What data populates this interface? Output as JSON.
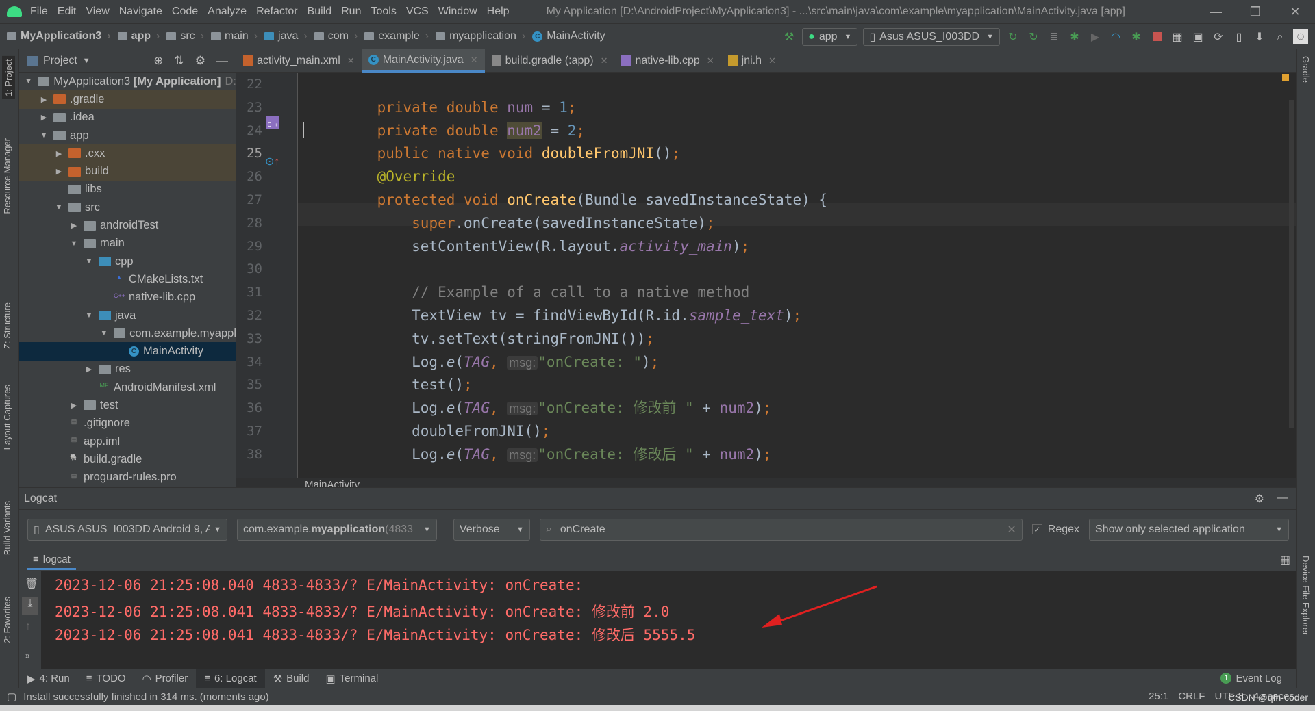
{
  "window": {
    "title": "My Application [D:\\AndroidProject\\MyApplication3] - ...\\src\\main\\java\\com\\example\\myapplication\\MainActivity.java [app]",
    "controls": [
      "—",
      "❐",
      "✕"
    ]
  },
  "menu": [
    "File",
    "Edit",
    "View",
    "Navigate",
    "Code",
    "Analyze",
    "Refactor",
    "Build",
    "Run",
    "Tools",
    "VCS",
    "Window",
    "Help"
  ],
  "breadcrumb": [
    "MyApplication3",
    "app",
    "src",
    "main",
    "java",
    "com",
    "example",
    "myapplication",
    "MainActivity"
  ],
  "toolbar": {
    "run_config": "app",
    "device": "Asus ASUS_I003DD"
  },
  "project_panel": {
    "title": "Project",
    "tree": [
      {
        "label": "MyApplication3 [My Application]",
        "suffix": "D:",
        "depth": 0,
        "arrow": "▼",
        "icon": "project"
      },
      {
        "label": ".gradle",
        "depth": 1,
        "arrow": "▶",
        "icon": "folder-orange",
        "ignored": true
      },
      {
        "label": ".idea",
        "depth": 1,
        "arrow": "▶",
        "icon": "folder"
      },
      {
        "label": "app",
        "depth": 1,
        "arrow": "▼",
        "icon": "folder"
      },
      {
        "label": ".cxx",
        "depth": 2,
        "arrow": "▶",
        "icon": "folder-orange",
        "ignored": true
      },
      {
        "label": "build",
        "depth": 2,
        "arrow": "▶",
        "icon": "folder-orange",
        "ignored": true
      },
      {
        "label": "libs",
        "depth": 2,
        "arrow": "",
        "icon": "folder"
      },
      {
        "label": "src",
        "depth": 2,
        "arrow": "▼",
        "icon": "folder"
      },
      {
        "label": "androidTest",
        "depth": 3,
        "arrow": "▶",
        "icon": "folder"
      },
      {
        "label": "main",
        "depth": 3,
        "arrow": "▼",
        "icon": "folder"
      },
      {
        "label": "cpp",
        "depth": 4,
        "arrow": "▼",
        "icon": "folder-blue"
      },
      {
        "label": "CMakeLists.txt",
        "depth": 5,
        "arrow": "",
        "icon": "cmake"
      },
      {
        "label": "native-lib.cpp",
        "depth": 5,
        "arrow": "",
        "icon": "cpp"
      },
      {
        "label": "java",
        "depth": 4,
        "arrow": "▼",
        "icon": "folder-blue"
      },
      {
        "label": "com.example.myappl",
        "depth": 5,
        "arrow": "▼",
        "icon": "package"
      },
      {
        "label": "MainActivity",
        "depth": 6,
        "arrow": "",
        "icon": "class",
        "selected": true
      },
      {
        "label": "res",
        "depth": 4,
        "arrow": "▶",
        "icon": "folder"
      },
      {
        "label": "AndroidManifest.xml",
        "depth": 4,
        "arrow": "",
        "icon": "manifest"
      },
      {
        "label": "test",
        "depth": 3,
        "arrow": "▶",
        "icon": "folder"
      },
      {
        "label": ".gitignore",
        "depth": 2,
        "arrow": "",
        "icon": "file"
      },
      {
        "label": "app.iml",
        "depth": 2,
        "arrow": "",
        "icon": "file"
      },
      {
        "label": "build.gradle",
        "depth": 2,
        "arrow": "",
        "icon": "gradle"
      },
      {
        "label": "proguard-rules.pro",
        "depth": 2,
        "arrow": "",
        "icon": "file"
      }
    ]
  },
  "tabs": [
    {
      "label": "activity_main.xml",
      "icon": "xml",
      "active": false
    },
    {
      "label": "MainActivity.java",
      "icon": "class",
      "active": true
    },
    {
      "label": "build.gradle (:app)",
      "icon": "gradle",
      "active": false
    },
    {
      "label": "native-lib.cpp",
      "icon": "cpp",
      "active": false
    },
    {
      "label": "jni.h",
      "icon": "header",
      "active": false
    }
  ],
  "editor": {
    "breadcrumb": "MainActivity",
    "caret_line": 25,
    "lines": [
      {
        "n": 22,
        "t": []
      },
      {
        "n": 23,
        "t": [
          [
            "    ",
            "pl"
          ],
          [
            "private double ",
            "kw"
          ],
          [
            "num",
            "fld"
          ],
          [
            " = ",
            "pl"
          ],
          [
            "1",
            "num"
          ],
          [
            ";",
            "kw"
          ]
        ]
      },
      {
        "n": 24,
        "t": [
          [
            "    ",
            "pl"
          ],
          [
            "private double ",
            "kw"
          ],
          [
            "num2",
            "fld hl"
          ],
          [
            " = ",
            "pl"
          ],
          [
            "2",
            "num"
          ],
          [
            ";",
            "kw"
          ]
        ]
      },
      {
        "n": 25,
        "t": [
          [
            "    ",
            "pl"
          ],
          [
            "public native void ",
            "kw"
          ],
          [
            "doubleFromJNI",
            "fn"
          ],
          [
            "()",
            "pl"
          ],
          [
            ";",
            "kw"
          ]
        ]
      },
      {
        "n": 26,
        "t": [
          [
            "    ",
            "pl"
          ],
          [
            "@Override",
            "ann"
          ]
        ]
      },
      {
        "n": 27,
        "t": [
          [
            "    ",
            "pl"
          ],
          [
            "protected void ",
            "kw"
          ],
          [
            "onCreate",
            "fn"
          ],
          [
            "(Bundle savedInstanceState) {",
            "pl"
          ]
        ]
      },
      {
        "n": 28,
        "t": [
          [
            "        ",
            "pl"
          ],
          [
            "super",
            "kw"
          ],
          [
            ".onCreate(savedInstanceState)",
            "pl"
          ],
          [
            ";",
            "kw"
          ]
        ]
      },
      {
        "n": 29,
        "t": [
          [
            "        setContentView(R.layout.",
            "pl"
          ],
          [
            "activity_main",
            "fld it"
          ],
          [
            ")",
            "pl"
          ],
          [
            ";",
            "kw"
          ]
        ]
      },
      {
        "n": 30,
        "t": []
      },
      {
        "n": 31,
        "t": [
          [
            "        ",
            "pl"
          ],
          [
            "// Example of a call to a native method",
            "cm"
          ]
        ]
      },
      {
        "n": 32,
        "t": [
          [
            "        TextView tv = findViewById(R.id.",
            "pl"
          ],
          [
            "sample_text",
            "fld it"
          ],
          [
            ")",
            "pl"
          ],
          [
            ";",
            "kw"
          ]
        ]
      },
      {
        "n": 33,
        "t": [
          [
            "        tv.setText(stringFromJNI())",
            "pl"
          ],
          [
            ";",
            "kw"
          ]
        ]
      },
      {
        "n": 34,
        "t": [
          [
            "        Log.",
            "pl"
          ],
          [
            "e",
            "pl it"
          ],
          [
            "(",
            "pl"
          ],
          [
            "TAG",
            "fld it"
          ],
          [
            ", ",
            "kw"
          ],
          [
            "msg:",
            "hint"
          ],
          [
            "\"onCreate: \"",
            "str"
          ],
          [
            ")",
            "pl"
          ],
          [
            ";",
            "kw"
          ]
        ]
      },
      {
        "n": 35,
        "t": [
          [
            "        test()",
            "pl"
          ],
          [
            ";",
            "kw"
          ]
        ]
      },
      {
        "n": 36,
        "t": [
          [
            "        Log.",
            "pl"
          ],
          [
            "e",
            "pl it"
          ],
          [
            "(",
            "pl"
          ],
          [
            "TAG",
            "fld it"
          ],
          [
            ", ",
            "kw"
          ],
          [
            "msg:",
            "hint"
          ],
          [
            "\"onCreate: 修改前 \"",
            "str"
          ],
          [
            " + ",
            "pl"
          ],
          [
            "num2",
            "fld"
          ],
          [
            ")",
            "pl"
          ],
          [
            ";",
            "kw"
          ]
        ]
      },
      {
        "n": 37,
        "t": [
          [
            "        doubleFromJNI()",
            "pl"
          ],
          [
            ";",
            "kw"
          ]
        ]
      },
      {
        "n": 38,
        "t": [
          [
            "        Log.",
            "pl"
          ],
          [
            "e",
            "pl it"
          ],
          [
            "(",
            "pl"
          ],
          [
            "TAG",
            "fld it"
          ],
          [
            ", ",
            "kw"
          ],
          [
            "msg:",
            "hint"
          ],
          [
            "\"onCreate: 修改后 \"",
            "str"
          ],
          [
            " + ",
            "pl"
          ],
          [
            "num2",
            "fld"
          ],
          [
            ")",
            "pl"
          ],
          [
            ";",
            "kw"
          ]
        ]
      }
    ]
  },
  "logcat": {
    "title": "Logcat",
    "device": "ASUS ASUS_I003DD Android 9, A",
    "process": {
      "prefix": "com.example.",
      "bold": "myapplication",
      "pid": " (4833"
    },
    "level": "Verbose",
    "search": "onCreate",
    "regex_label": "Regex",
    "regex_checked": true,
    "filter": "Show only selected application",
    "tab": "logcat",
    "lines": [
      "2023-12-06 21:25:08.040 4833-4833/? E/MainActivity: onCreate: ",
      "2023-12-06 21:25:08.041 4833-4833/? E/MainActivity: onCreate: 修改前 2.0",
      "2023-12-06 21:25:08.041 4833-4833/? E/MainActivity: onCreate: 修改后 5555.5"
    ],
    "error_color": "#ff6b68",
    "annotation_arrow_color": "#e02020"
  },
  "side_tabs": {
    "left": [
      "1: Project",
      "Resource Manager",
      "Z: Structure",
      "Layout Captures",
      "Build Variants",
      "2: Favorites"
    ],
    "right": [
      "Gradle",
      "Device File Explorer"
    ]
  },
  "bottom_tabs": [
    {
      "label": "4: Run"
    },
    {
      "label": "TODO"
    },
    {
      "label": "Profiler"
    },
    {
      "label": "6: Logcat",
      "active": true
    },
    {
      "label": "Build"
    },
    {
      "label": "Terminal"
    }
  ],
  "event_log": {
    "label": "Event Log",
    "count": "1"
  },
  "status": {
    "message": "Install successfully finished in 314 ms. (moments ago)",
    "position": "25:1",
    "line_sep": "CRLF",
    "encoding": "UTF-8",
    "indent": "4 spaces",
    "watermark": "CSDN @qfh-coder"
  }
}
